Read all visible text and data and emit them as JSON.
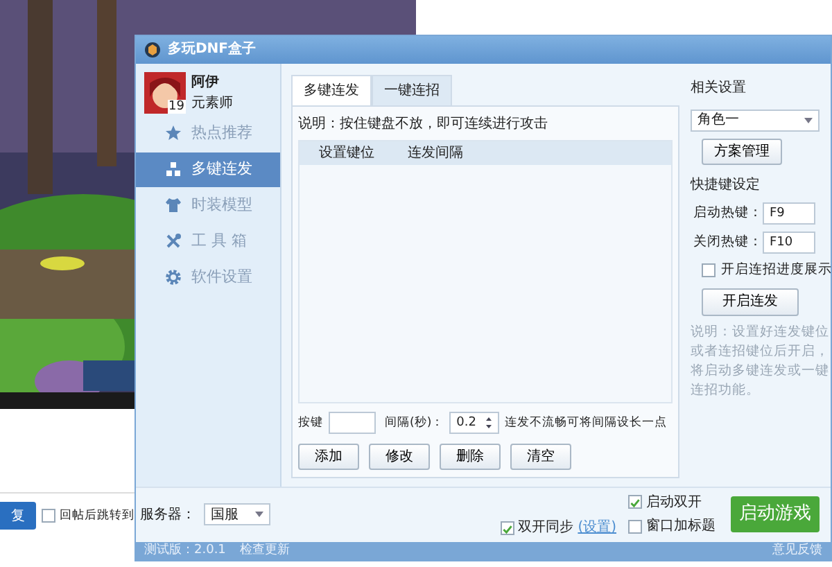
{
  "background_page": {
    "button": "复",
    "checkbox": {
      "label": "回帖后跳转到",
      "checked": false
    }
  },
  "window": {
    "title": "多玩DNF盒子"
  },
  "profile": {
    "name": "阿伊",
    "level": "19",
    "class": "元素师"
  },
  "sidebar": {
    "items": [
      {
        "label": "热点推荐",
        "selected": false
      },
      {
        "label": "多键连发",
        "selected": true
      },
      {
        "label": "时装模型",
        "selected": false
      },
      {
        "label": "工 具 箱",
        "selected": false
      },
      {
        "label": "软件设置",
        "selected": false
      }
    ]
  },
  "tabs": [
    {
      "label": "多键连发",
      "selected": true
    },
    {
      "label": "一键连招",
      "selected": false
    }
  ],
  "panel": {
    "description": "说明：按住键盘不放，即可连续进行攻击",
    "table": {
      "columns": [
        "设置键位",
        "连发间隔"
      ]
    },
    "key_label": "按键",
    "interval_label": "间隔(秒)：",
    "interval_value": "0.2",
    "hint": "连发不流畅可将间隔设长一点",
    "buttons": [
      "添加",
      "修改",
      "删除",
      "清空"
    ]
  },
  "settings": {
    "title": "相关设置",
    "profile_select": "角色一",
    "scheme_button": "方案管理",
    "hotkeys_title": "快捷键设定",
    "hotkeys": [
      {
        "label": "启动热键：",
        "value": "F9"
      },
      {
        "label": "关闭热键：",
        "value": "F10"
      }
    ],
    "progress_checkbox": {
      "label": "开启连招进度展示",
      "checked": false
    },
    "start_button": "开启连发",
    "note": "说明：设置好连发键位或者连招键位后开启，将启动多键连发或一键连招功能。"
  },
  "footer": {
    "server_label": "服务器：",
    "server": "国服",
    "sync": {
      "label": "双开同步",
      "checked": true,
      "link": "(设置)"
    },
    "options": [
      {
        "label": "启动双开",
        "checked": true
      },
      {
        "label": "窗口加标题",
        "checked": false
      }
    ],
    "launch_button": "启动游戏"
  },
  "status_bar": {
    "version": "测试版：2.0.1",
    "update": "检查更新",
    "feedback": "意见反馈"
  }
}
